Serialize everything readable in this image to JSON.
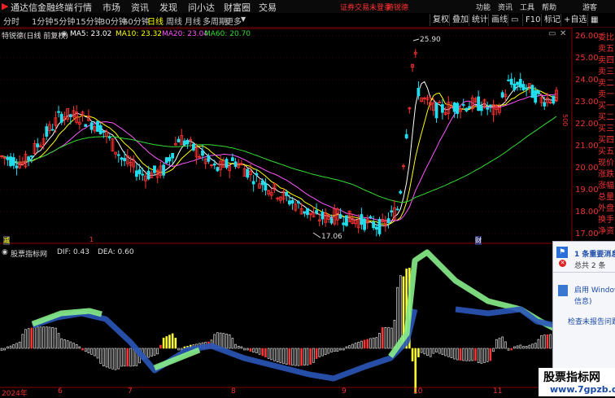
{
  "titlebar": {
    "app_title": "通达信金融终端",
    "menu": [
      "行情",
      "市场",
      "资讯",
      "发现",
      "问小达",
      "财富圈",
      "交易"
    ],
    "status": "证券交易未登录",
    "stock": "特锐德",
    "right": [
      "功能",
      "资讯",
      "工具",
      "帮助",
      "游客"
    ]
  },
  "toolbar": {
    "periods": [
      "分时",
      "1分钟",
      "5分钟",
      "15分钟",
      "30分钟",
      "60分钟",
      "日线",
      "周线",
      "月线",
      "多周期",
      "更多"
    ],
    "selected": "日线",
    "right_buttons": [
      "复权",
      "叠加",
      "统计",
      "画线",
      "F10",
      "标记",
      "+自选"
    ]
  },
  "info": {
    "name": "特锐德(日线 前复权)",
    "ma": [
      {
        "label": "MA5: 23.02",
        "color": "#ffffff"
      },
      {
        "label": "MA10: 23.32",
        "color": "#ffff00"
      },
      {
        "label": "MA20: 23.04",
        "color": "#ff55ff"
      },
      {
        "label": "MA60: 20.70",
        "color": "#33dd33"
      }
    ]
  },
  "price_axis": [
    "26.00",
    "25.00",
    "24.00",
    "23.00",
    "22.00",
    "21.00",
    "20.00",
    "19.00",
    "18.00",
    "17.00"
  ],
  "right_labels": [
    "委比",
    "卖五",
    "卖四",
    "卖三",
    "卖二",
    "卖一",
    "买一",
    "买二",
    "买三",
    "买四",
    "买五",
    "现价",
    "涨跌",
    "涨幅",
    "总量",
    "外盘",
    "换手",
    "净资"
  ],
  "annotations": {
    "high": "25.90",
    "low": "17.06",
    "volume_marker": "500"
  },
  "markers": {
    "left": "减",
    "mid_red": "1",
    "right": "财"
  },
  "indicator": {
    "name": "股票指标网",
    "dif": "DIF: 0.43",
    "dea": "DEA: 0.60"
  },
  "dates": [
    "2024年",
    "6",
    "7",
    "8",
    "9",
    "10",
    "11"
  ],
  "popup": {
    "line1": "1 条重要消息",
    "line2": "总共 2 条",
    "line3": "启用 Windows",
    "line4": "信息)",
    "line5": "检查未报告问题"
  },
  "watermark": {
    "title": "股票指标网",
    "url": "www.7gpzb.com"
  },
  "colors": {
    "up": "#ff3333",
    "down": "#22ddee",
    "bg": "#000000",
    "accent": "#ff2020"
  }
}
